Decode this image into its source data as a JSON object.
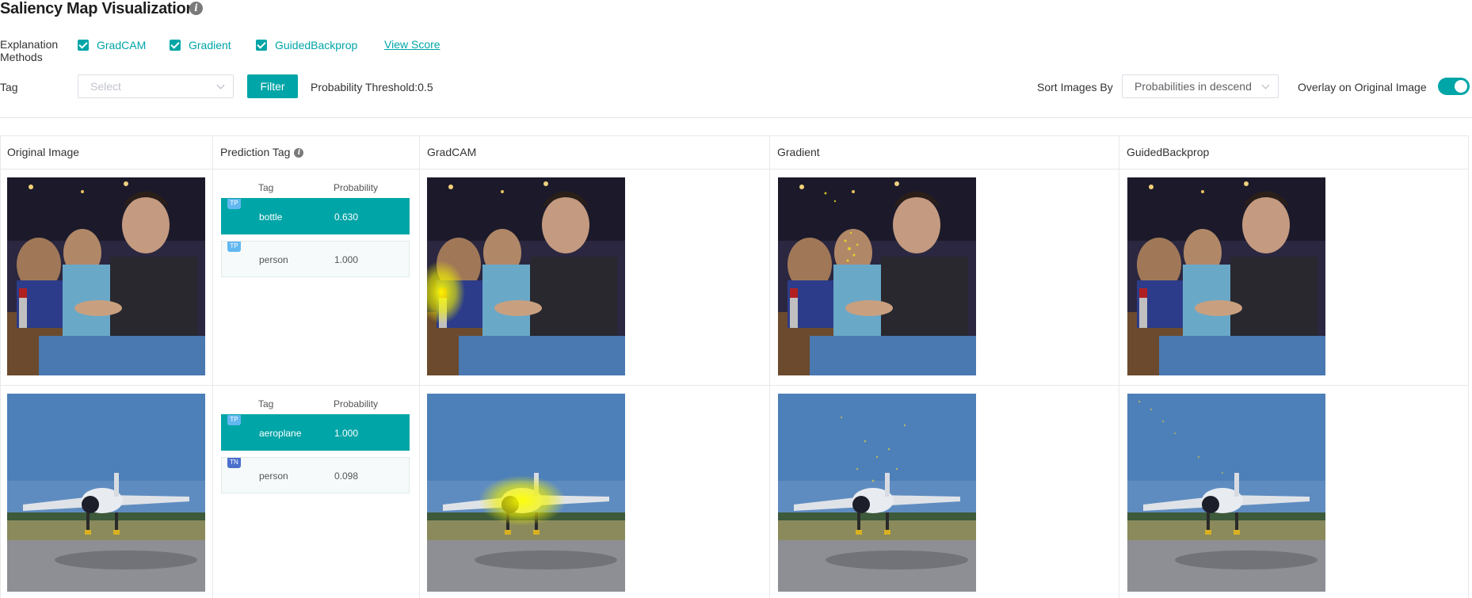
{
  "header": {
    "title": "Saliency Map Visualization"
  },
  "controls": {
    "methods_label": "Explanation Methods",
    "methods": [
      {
        "label": "GradCAM",
        "checked": true
      },
      {
        "label": "Gradient",
        "checked": true
      },
      {
        "label": "GuidedBackprop",
        "checked": true
      }
    ],
    "view_score": "View Score",
    "tag_label": "Tag",
    "tag_placeholder": "Select",
    "filter_button": "Filter",
    "threshold": "Probability Threshold:0.5",
    "sort_label": "Sort Images By",
    "sort_value": "Probabilities in descend",
    "overlay_label": "Overlay on Original Image",
    "overlay_enabled": true
  },
  "table": {
    "columns": [
      "Original Image",
      "Prediction Tag",
      "GradCAM",
      "Gradient",
      "GuidedBackprop"
    ],
    "pred_headers": {
      "tag": "Tag",
      "probability": "Probability"
    },
    "rows": [
      {
        "image": "party-photo",
        "predictions": [
          {
            "badge": "TP",
            "tag": "bottle",
            "probability": "0.630",
            "selected": true
          },
          {
            "badge": "TP",
            "tag": "person",
            "probability": "1.000",
            "selected": false
          }
        ]
      },
      {
        "image": "aircraft-photo",
        "predictions": [
          {
            "badge": "TP",
            "tag": "aeroplane",
            "probability": "1.000",
            "selected": true
          },
          {
            "badge": "TN",
            "tag": "person",
            "probability": "0.098",
            "selected": false
          }
        ]
      }
    ]
  },
  "colors": {
    "accent": "#00a5a7",
    "tp_badge": "#62b8f0",
    "tn_badge": "#4a6fcc"
  },
  "icons": [
    "info-icon",
    "checkbox-checked-icon",
    "chevron-down-icon",
    "toggle-switch"
  ]
}
